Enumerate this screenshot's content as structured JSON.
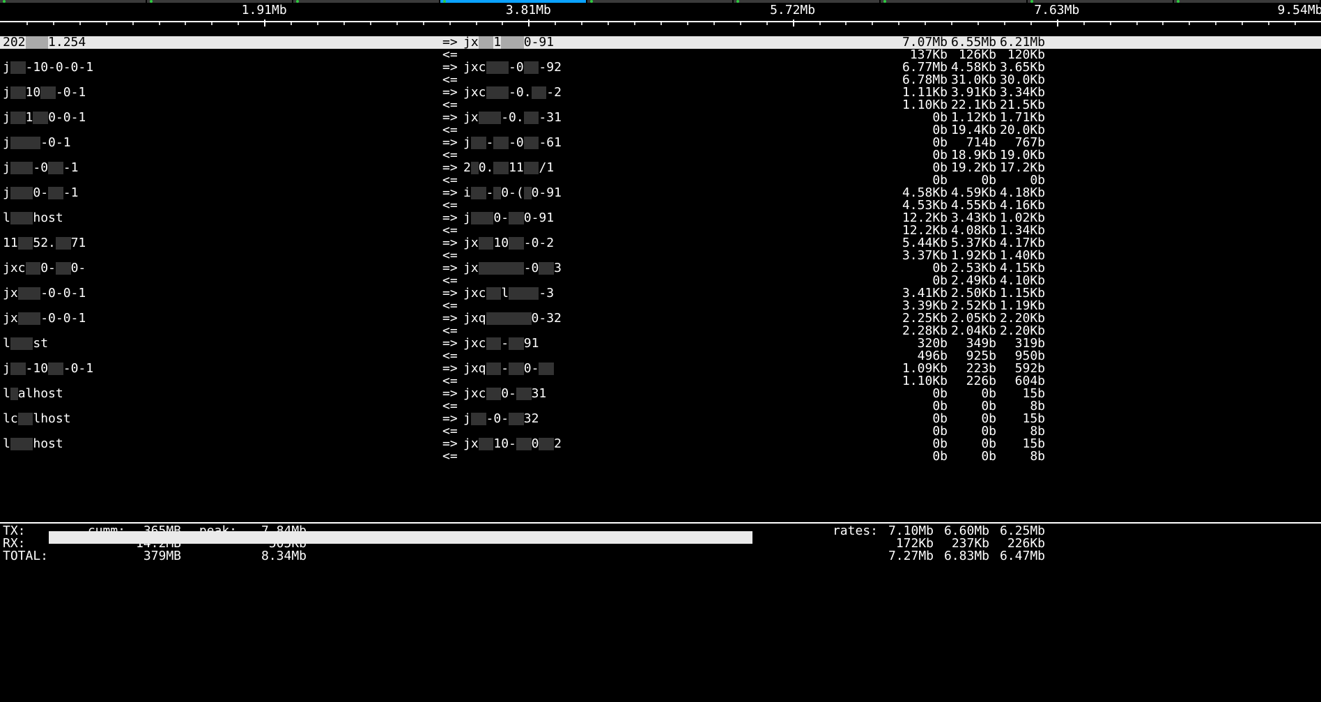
{
  "tabs": [
    {
      "active": false
    },
    {
      "active": false
    },
    {
      "active": false
    },
    {
      "active": true
    },
    {
      "active": false
    },
    {
      "active": false
    },
    {
      "active": false
    },
    {
      "active": false
    },
    {
      "active": false
    }
  ],
  "scale": {
    "labels": [
      "1.91Mb",
      "3.81Mb",
      "5.72Mb",
      "7.63Mb",
      "9.54Mb"
    ],
    "positions_pct": [
      20,
      40,
      60,
      80,
      100
    ]
  },
  "connections": [
    {
      "src": "202███1.254",
      "dst": "jx██1███0-91",
      "highlight": true,
      "bar_pct": 69,
      "tx": [
        "7.07Mb",
        "6.55Mb",
        "6.21Mb"
      ],
      "rx": [
        "137Kb",
        "126Kb",
        "120Kb"
      ]
    },
    {
      "src": "j██-10-0-0-1",
      "dst": "jxc███-0██-92",
      "tx": [
        "6.77Mb",
        "4.58Kb",
        "3.65Kb"
      ],
      "rx": [
        "6.78Mb",
        "31.0Kb",
        "30.0Kb"
      ]
    },
    {
      "src": "j██10██-0-1",
      "dst": "jxc███-0.██-2",
      "tx": [
        "1.11Kb",
        "3.91Kb",
        "3.34Kb"
      ],
      "rx": [
        "1.10Kb",
        "22.1Kb",
        "21.5Kb"
      ]
    },
    {
      "src": "j██1██0-0-1",
      "dst": "jx███-0.██-31",
      "tx": [
        "0b",
        "1.12Kb",
        "1.71Kb"
      ],
      "rx": [
        "0b",
        "19.4Kb",
        "20.0Kb"
      ]
    },
    {
      "src": "j████-0-1",
      "dst": "j██-██-0██-61",
      "tx": [
        "0b",
        "714b",
        "767b"
      ],
      "rx": [
        "0b",
        "18.9Kb",
        "19.0Kb"
      ]
    },
    {
      "src": "j███-0██-1",
      "dst": "2█0.██11██/1",
      "tx": [
        "0b",
        "19.2Kb",
        "17.2Kb"
      ],
      "rx": [
        "0b",
        "0b",
        "0b"
      ]
    },
    {
      "src": "j███0-██-1",
      "dst": "i██-█0-(█0-91",
      "tx": [
        "4.58Kb",
        "4.59Kb",
        "4.18Kb"
      ],
      "rx": [
        "4.53Kb",
        "4.55Kb",
        "4.16Kb"
      ]
    },
    {
      "src": "l███host",
      "dst": "j███0-██0-91",
      "tx": [
        "12.2Kb",
        "3.43Kb",
        "1.02Kb"
      ],
      "rx": [
        "12.2Kb",
        "4.08Kb",
        "1.34Kb"
      ]
    },
    {
      "src": "11██52.██71",
      "dst": "jx██10██-0-2",
      "tx": [
        "5.44Kb",
        "5.37Kb",
        "4.17Kb"
      ],
      "rx": [
        "3.37Kb",
        "1.92Kb",
        "1.40Kb"
      ]
    },
    {
      "src": "jxc██0-██0-",
      "dst": "jx██████-0██3",
      "tx": [
        "0b",
        "2.53Kb",
        "4.15Kb"
      ],
      "rx": [
        "0b",
        "2.49Kb",
        "4.10Kb"
      ]
    },
    {
      "src": "jx███-0-0-1",
      "dst": "jxc██l████-3",
      "tx": [
        "3.41Kb",
        "2.50Kb",
        "1.15Kb"
      ],
      "rx": [
        "3.39Kb",
        "2.52Kb",
        "1.19Kb"
      ]
    },
    {
      "src": "jx███-0-0-1",
      "dst": "jxq██████0-32",
      "tx": [
        "2.25Kb",
        "2.05Kb",
        "2.20Kb"
      ],
      "rx": [
        "2.28Kb",
        "2.04Kb",
        "2.20Kb"
      ]
    },
    {
      "src": "l███st",
      "dst": "jxc██-██91",
      "tx": [
        "320b",
        "349b",
        "319b"
      ],
      "rx": [
        "496b",
        "925b",
        "950b"
      ]
    },
    {
      "src": "j██-10██-0-1",
      "dst": "jxq██-██0-██",
      "tx": [
        "1.09Kb",
        "223b",
        "592b"
      ],
      "rx": [
        "1.10Kb",
        "226b",
        "604b"
      ]
    },
    {
      "src": "l█alhost",
      "dst": "jxc██0-██31",
      "tx": [
        "0b",
        "0b",
        "15b"
      ],
      "rx": [
        "0b",
        "0b",
        "8b"
      ]
    },
    {
      "src": "lc██lhost",
      "dst": "j██-0-██32",
      "tx": [
        "0b",
        "0b",
        "15b"
      ],
      "rx": [
        "0b",
        "0b",
        "8b"
      ]
    },
    {
      "src": "l███host",
      "dst": "jx██10-██0██2",
      "tx": [
        "0b",
        "0b",
        "15b"
      ],
      "rx": [
        "0b",
        "0b",
        "8b"
      ]
    }
  ],
  "arrows": {
    "tx": "=>",
    "rx": "<="
  },
  "summary": {
    "tx": {
      "label": "TX:",
      "cumm_label": "cumm:",
      "cumm": "365MB",
      "peak_label": "peak:",
      "peak": "7.84Mb",
      "bar_pct": 69,
      "rates_label": "rates:",
      "r1": "7.10Mb",
      "r2": "6.60Mb",
      "r3": "6.25Mb"
    },
    "rx": {
      "label": "RX:",
      "cumm": "14.2MB",
      "peak": "505Kb",
      "r1": "172Kb",
      "r2": "237Kb",
      "r3": "226Kb"
    },
    "total": {
      "label": "TOTAL:",
      "cumm": "379MB",
      "peak": "8.34Mb",
      "r1": "7.27Mb",
      "r2": "6.83Mb",
      "r3": "6.47Mb"
    }
  }
}
